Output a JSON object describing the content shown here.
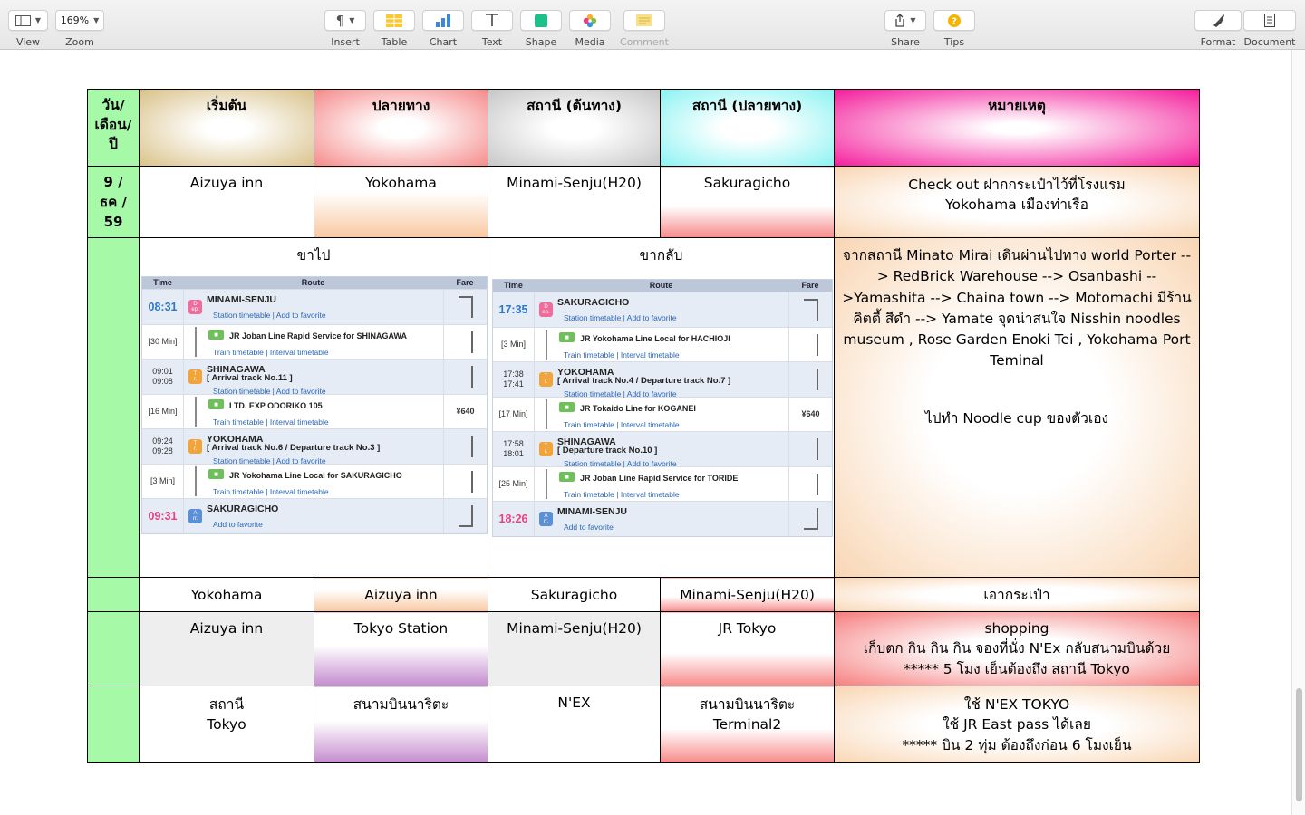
{
  "toolbar": {
    "view": "View",
    "zoom_value": "169%",
    "zoom": "Zoom",
    "insert": "Insert",
    "table": "Table",
    "chart": "Chart",
    "text": "Text",
    "shape": "Shape",
    "media": "Media",
    "comment": "Comment",
    "share": "Share",
    "tips": "Tips",
    "format": "Format",
    "document": "Document"
  },
  "table": {
    "headers": [
      "วัน/\nเดือน/\nปี",
      "เริ่มต้น",
      "ปลายทาง",
      "สถานี (ต้นทาง)",
      "สถานี (ปลายทาง)",
      "หมายเหตุ"
    ],
    "row1": {
      "date": "9 /\nธค /\n59",
      "start": "Aizuya inn",
      "dest": "Yokohama",
      "st_from": "Minami-Senju(H20)",
      "st_to": "Sakuragicho",
      "note": "Check out ฝากกระเป๋าไว้ที่โรงแรม\nYokohama เมืองท่าเรือ"
    },
    "route_row": {
      "go_title": "ขาไป",
      "back_title": "ขากลับ",
      "note": "จากสถานี Minato Mirai เดินผ่านไปทาง world Porter -->  RedBrick Warehouse --> Osanbashi -->Yamashita --> Chaina town --> Motomachi มีร้านคิตตี้ สีดำ --> Yamate\nจุดน่าสนใจ Nisshin noodles museum , Rose Garden Enoki Tei , Yokohama Port Teminal",
      "note2": "ไปทำ Noodle cup ของตัวเอง"
    },
    "row3": {
      "start": "Yokohama",
      "dest": "Aizuya inn",
      "st_from": "Sakuragicho",
      "st_to": "Minami-Senju(H20)",
      "note": "เอากระเป๋า"
    },
    "row4": {
      "start": "Aizuya inn",
      "dest": "Tokyo Station",
      "st_from": "Minami-Senju(H20)",
      "st_to": "JR Tokyo",
      "note": "shopping\nเก็บตก กิน กิน กิน จองที่นั่ง N'Ex กลับสนามบินด้วย\n***** 5 โมง เย็นต้องถึง สถานี Tokyo"
    },
    "row5": {
      "start": "สถานี\nTokyo",
      "dest": "สนามบินนาริตะ",
      "st_from": "N'EX",
      "st_to": "สนามบินนาริตะ\nTerminal2",
      "note": "ใช้ N'EX TOKYO\nใช้ JR East pass ได้เลย\n***** บิน 2 ทุ่ม ต้องถึงก่อน 6 โมงเย็น"
    }
  },
  "route_go": {
    "col_time": "Time",
    "col_route": "Route",
    "col_fare": "Fare",
    "fare": "¥640",
    "dep_time": "08:31",
    "dep_station": "MINAMI-SENJU",
    "links_station": "Station timetable | Add to favorite",
    "links_train": "Train timetable | Interval timetable",
    "seg1_dur": "[30 Min]",
    "seg1_train": "JR Joban Line Rapid Service  for SHINAGAWA",
    "tr1_times": "09:01\n09:08",
    "tr1_station": "SHINAGAWA",
    "tr1_track": "[ Arrival track No.11 ]",
    "seg2_dur": "[16 Min]",
    "seg2_train": "LTD. EXP ODORIKO 105",
    "tr2_times": "09:24\n09:28",
    "tr2_station": "YOKOHAMA",
    "tr2_track": "[ Arrival track No.6 / Departure track No.3 ]",
    "seg3_dur": "[3 Min]",
    "seg3_train": "JR Yokohama Line Local  for SAKURAGICHO",
    "arr_time": "09:31",
    "arr_station": "SAKURAGICHO",
    "arr_link": "Add to favorite"
  },
  "route_back": {
    "col_time": "Time",
    "col_route": "Route",
    "col_fare": "Fare",
    "fare": "¥640",
    "dep_time": "17:35",
    "dep_station": "SAKURAGICHO",
    "links_station": "Station timetable | Add to favorite",
    "links_train": "Train timetable | Interval timetable",
    "seg1_dur": "[3 Min]",
    "seg1_train": "JR Yokohama Line Local  for HACHIOJI",
    "tr1_times": "17:38\n17:41",
    "tr1_station": "YOKOHAMA",
    "tr1_track": "[ Arrival track No.4 / Departure track No.7 ]",
    "seg2_dur": "[17 Min]",
    "seg2_train": "JR Tokaido Line  for KOGANEI",
    "tr2_times": "17:58\n18:01",
    "tr2_station": "SHINAGAWA",
    "tr2_track": "[ Departure track No.10 ]",
    "seg3_dur": "[25 Min]",
    "seg3_train": "JR Joban Line Rapid Service  for TORIDE",
    "arr_time": "18:26",
    "arr_station": "MINAMI-SENJU",
    "arr_link": "Add to favorite"
  },
  "badges": {
    "dep": "D\nep.",
    "tr": "T\nr.",
    "arr": "A\nrr."
  },
  "colors": {
    "date_column": "#a5f9a7",
    "toolbar_bg": "#ececec",
    "link_blue": "#2a66b8",
    "dep_time_blue": "#2d77c9",
    "arr_time_pink": "#e8407e"
  }
}
